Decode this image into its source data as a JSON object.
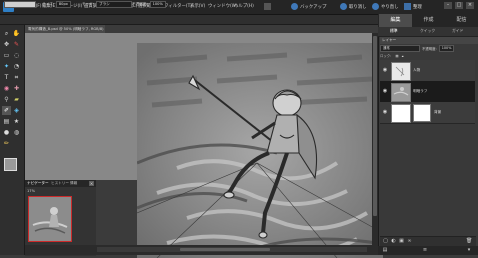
{
  "app": {
    "logo_text": "PSE",
    "menus": [
      "ファイル(F)",
      "編集(E)",
      "イメージ(I)",
      "画質調整(N)",
      "レイヤー(L)",
      "選択範囲(S)",
      "フィルター(T)",
      "表示(V)",
      "ウィンドウ(W)",
      "ヘルプ(H)"
    ],
    "controls": {
      "backup": "バックアップ",
      "undo": "取り消し",
      "redo": "やり直し",
      "organize": "整理"
    }
  },
  "options_bar": {
    "size_label": "サイズ:",
    "size_value": "80px",
    "mode_label": "モード:",
    "mode_value": "ブラシ",
    "opacity_label": "不透明度:",
    "opacity_value": "100%"
  },
  "document": {
    "tab_title": "電気的構造_B.psd @ 50% (明暗ラフ, RGB/8)"
  },
  "navigator": {
    "tabs": [
      "ナビゲーター",
      "ヒストリー",
      "情報"
    ],
    "zoom": "17%"
  },
  "panel": {
    "modes": [
      "編集",
      "作成",
      "配信"
    ],
    "subtabs": [
      "標準",
      "クイック",
      "ガイド"
    ],
    "layer_header": "レイヤー",
    "blend_mode": "通常",
    "opacity_label": "不透明度:",
    "opacity_value": "100%",
    "lock_label": "ロック:",
    "layers": [
      {
        "name": "人物"
      },
      {
        "name": "明暗ラフ"
      },
      {
        "name": "背景"
      }
    ]
  }
}
